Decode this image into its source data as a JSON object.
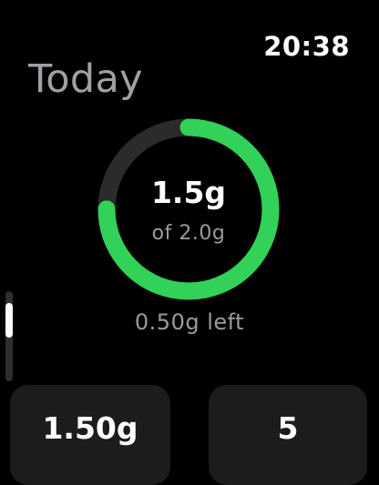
{
  "status_bar": {
    "time": "20:38"
  },
  "header": {
    "title": "Today"
  },
  "progress_ring": {
    "value_label": "1.5g",
    "total_label": "of 2.0g",
    "progress_fraction": 0.75,
    "ring_color": "#32d158",
    "track_color": "#2b2b2d"
  },
  "remaining_label": "0.50g left",
  "scroll": {
    "position_fraction": 0.0
  },
  "cards": [
    {
      "value": "1.50g"
    },
    {
      "value": "5"
    }
  ],
  "colors": {
    "background": "#000000",
    "accent": "#32d158",
    "card_background": "#1c1c1e"
  }
}
